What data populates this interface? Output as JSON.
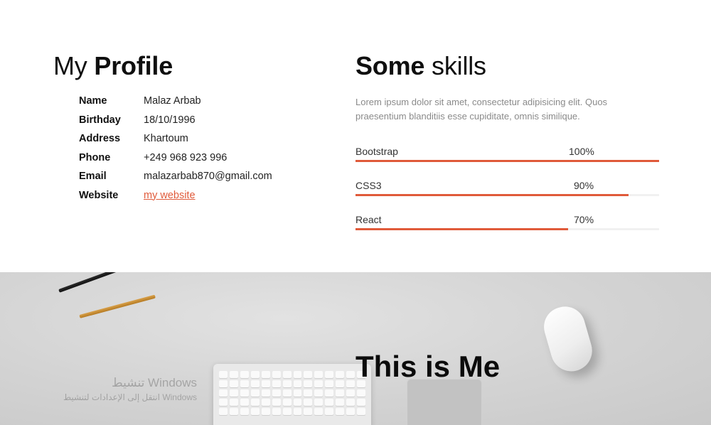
{
  "profile": {
    "title_light": "My",
    "title_bold": "Profile",
    "rows": [
      {
        "label": "Name",
        "value": "Malaz Arbab"
      },
      {
        "label": "Birthday",
        "value": "18/10/1996"
      },
      {
        "label": "Address",
        "value": "Khartoum"
      },
      {
        "label": "Phone",
        "value": "+249 968 923 996"
      },
      {
        "label": "Email",
        "value": "malazarbab870@gmail.com"
      },
      {
        "label": "Website",
        "value": "my website"
      }
    ]
  },
  "skills": {
    "title_bold": "Some",
    "title_light": "skills",
    "description": "Lorem ipsum dolor sit amet, consectetur adipisicing elit. Quos praesentium blanditiis esse cupiditate, omnis similique.",
    "items": [
      {
        "name": "Bootstrap",
        "percent_label": "100%",
        "level": 1.0
      },
      {
        "name": "CSS3",
        "percent_label": "90%",
        "level": 0.9
      },
      {
        "name": "React",
        "percent_label": "70%",
        "level": 0.7
      }
    ],
    "bar_color": "#e05a3a"
  },
  "hero": {
    "title_light": "This is",
    "title_bold": "Me"
  },
  "watermark": {
    "line1": "تنشيط Windows",
    "line2": "انتقل إلى الإعدادات لتنشيط Windows"
  }
}
